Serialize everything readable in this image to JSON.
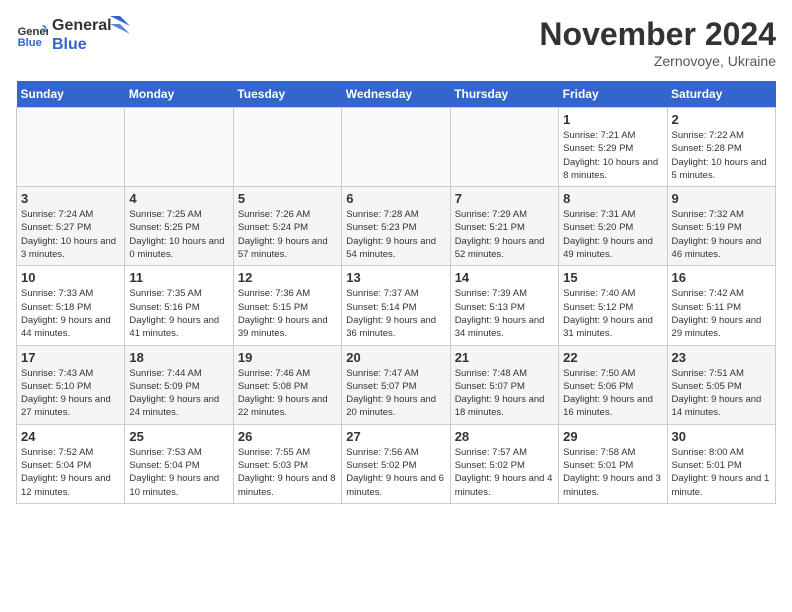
{
  "header": {
    "logo_line1": "General",
    "logo_line2": "Blue",
    "month": "November 2024",
    "location": "Zernovoye, Ukraine"
  },
  "days_of_week": [
    "Sunday",
    "Monday",
    "Tuesday",
    "Wednesday",
    "Thursday",
    "Friday",
    "Saturday"
  ],
  "weeks": [
    [
      {
        "day": "",
        "empty": true
      },
      {
        "day": "",
        "empty": true
      },
      {
        "day": "",
        "empty": true
      },
      {
        "day": "",
        "empty": true
      },
      {
        "day": "",
        "empty": true
      },
      {
        "day": "1",
        "rise": "7:21 AM",
        "set": "5:29 PM",
        "daylight": "10 hours and 8 minutes."
      },
      {
        "day": "2",
        "rise": "7:22 AM",
        "set": "5:28 PM",
        "daylight": "10 hours and 5 minutes."
      }
    ],
    [
      {
        "day": "3",
        "rise": "7:24 AM",
        "set": "5:27 PM",
        "daylight": "10 hours and 3 minutes."
      },
      {
        "day": "4",
        "rise": "7:25 AM",
        "set": "5:25 PM",
        "daylight": "10 hours and 0 minutes."
      },
      {
        "day": "5",
        "rise": "7:26 AM",
        "set": "5:24 PM",
        "daylight": "9 hours and 57 minutes."
      },
      {
        "day": "6",
        "rise": "7:28 AM",
        "set": "5:23 PM",
        "daylight": "9 hours and 54 minutes."
      },
      {
        "day": "7",
        "rise": "7:29 AM",
        "set": "5:21 PM",
        "daylight": "9 hours and 52 minutes."
      },
      {
        "day": "8",
        "rise": "7:31 AM",
        "set": "5:20 PM",
        "daylight": "9 hours and 49 minutes."
      },
      {
        "day": "9",
        "rise": "7:32 AM",
        "set": "5:19 PM",
        "daylight": "9 hours and 46 minutes."
      }
    ],
    [
      {
        "day": "10",
        "rise": "7:33 AM",
        "set": "5:18 PM",
        "daylight": "9 hours and 44 minutes."
      },
      {
        "day": "11",
        "rise": "7:35 AM",
        "set": "5:16 PM",
        "daylight": "9 hours and 41 minutes."
      },
      {
        "day": "12",
        "rise": "7:36 AM",
        "set": "5:15 PM",
        "daylight": "9 hours and 39 minutes."
      },
      {
        "day": "13",
        "rise": "7:37 AM",
        "set": "5:14 PM",
        "daylight": "9 hours and 36 minutes."
      },
      {
        "day": "14",
        "rise": "7:39 AM",
        "set": "5:13 PM",
        "daylight": "9 hours and 34 minutes."
      },
      {
        "day": "15",
        "rise": "7:40 AM",
        "set": "5:12 PM",
        "daylight": "9 hours and 31 minutes."
      },
      {
        "day": "16",
        "rise": "7:42 AM",
        "set": "5:11 PM",
        "daylight": "9 hours and 29 minutes."
      }
    ],
    [
      {
        "day": "17",
        "rise": "7:43 AM",
        "set": "5:10 PM",
        "daylight": "9 hours and 27 minutes."
      },
      {
        "day": "18",
        "rise": "7:44 AM",
        "set": "5:09 PM",
        "daylight": "9 hours and 24 minutes."
      },
      {
        "day": "19",
        "rise": "7:46 AM",
        "set": "5:08 PM",
        "daylight": "9 hours and 22 minutes."
      },
      {
        "day": "20",
        "rise": "7:47 AM",
        "set": "5:07 PM",
        "daylight": "9 hours and 20 minutes."
      },
      {
        "day": "21",
        "rise": "7:48 AM",
        "set": "5:07 PM",
        "daylight": "9 hours and 18 minutes."
      },
      {
        "day": "22",
        "rise": "7:50 AM",
        "set": "5:06 PM",
        "daylight": "9 hours and 16 minutes."
      },
      {
        "day": "23",
        "rise": "7:51 AM",
        "set": "5:05 PM",
        "daylight": "9 hours and 14 minutes."
      }
    ],
    [
      {
        "day": "24",
        "rise": "7:52 AM",
        "set": "5:04 PM",
        "daylight": "9 hours and 12 minutes."
      },
      {
        "day": "25",
        "rise": "7:53 AM",
        "set": "5:04 PM",
        "daylight": "9 hours and 10 minutes."
      },
      {
        "day": "26",
        "rise": "7:55 AM",
        "set": "5:03 PM",
        "daylight": "9 hours and 8 minutes."
      },
      {
        "day": "27",
        "rise": "7:56 AM",
        "set": "5:02 PM",
        "daylight": "9 hours and 6 minutes."
      },
      {
        "day": "28",
        "rise": "7:57 AM",
        "set": "5:02 PM",
        "daylight": "9 hours and 4 minutes."
      },
      {
        "day": "29",
        "rise": "7:58 AM",
        "set": "5:01 PM",
        "daylight": "9 hours and 3 minutes."
      },
      {
        "day": "30",
        "rise": "8:00 AM",
        "set": "5:01 PM",
        "daylight": "9 hours and 1 minute."
      }
    ]
  ]
}
